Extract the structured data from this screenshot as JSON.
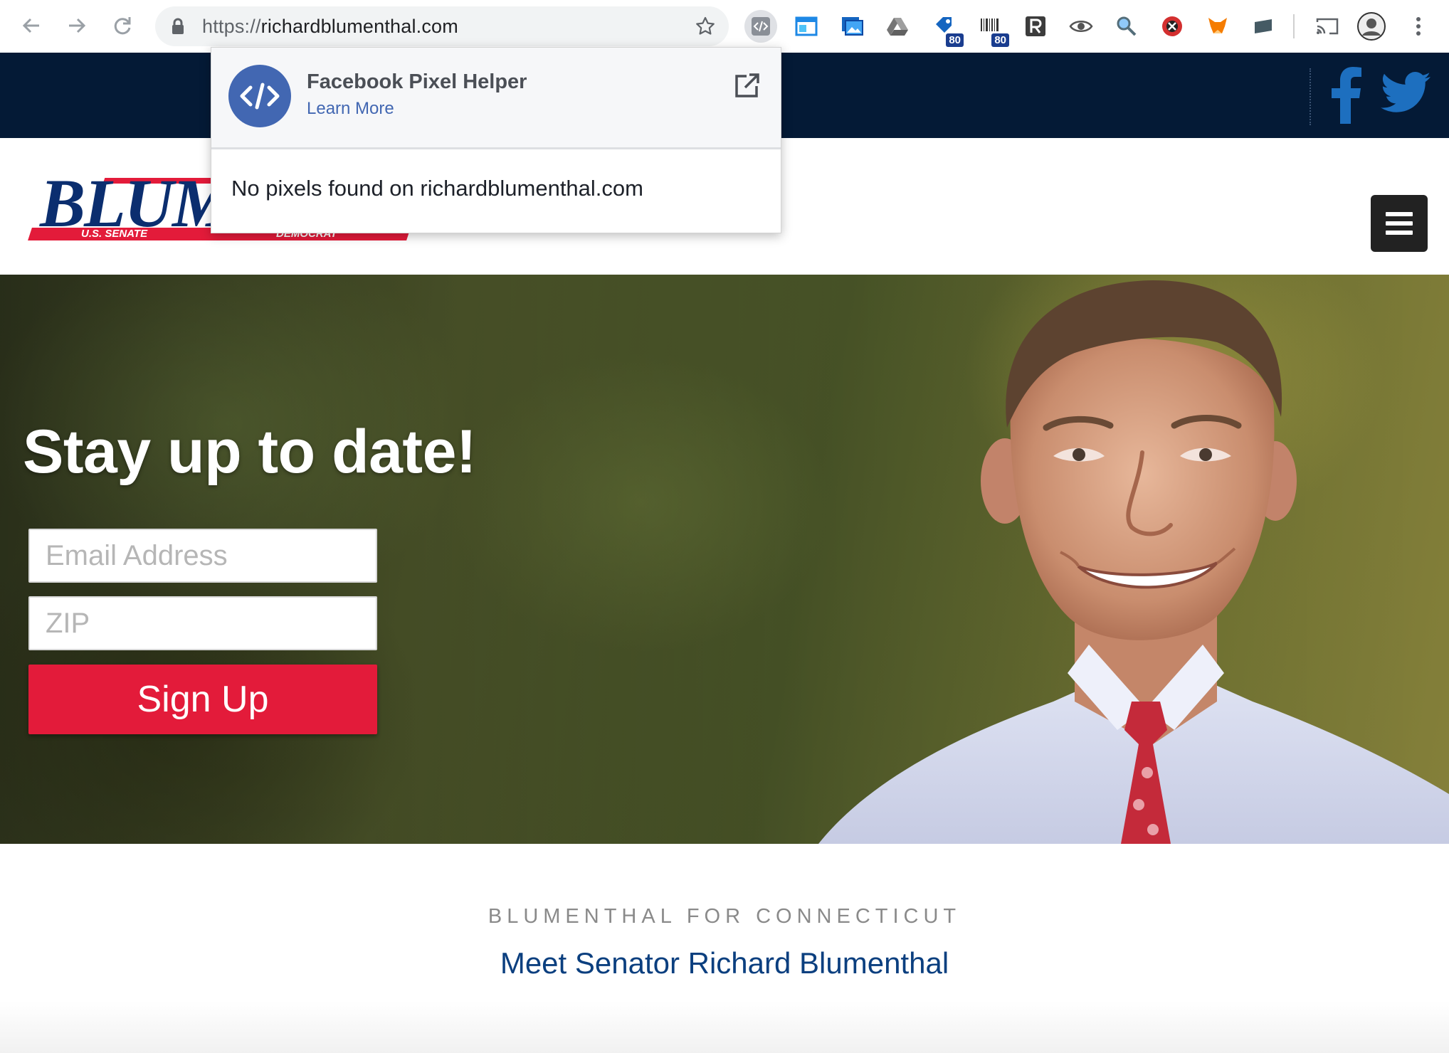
{
  "browser": {
    "url_scheme": "https://",
    "url_host": "richardblumenthal.com",
    "extension_badges": [
      "80",
      "80"
    ]
  },
  "logo": {
    "name": "BLUM",
    "office": "U.S. SENATE",
    "party": "DEMOCRAT"
  },
  "hero": {
    "heading": "Stay up to date!",
    "email_placeholder": "Email Address",
    "zip_placeholder": "ZIP",
    "signup_label": "Sign Up"
  },
  "intro": {
    "kicker": "BLUMENTHAL FOR CONNECTICUT",
    "link_text": "Meet Senator Richard Blumenthal"
  },
  "popup": {
    "title": "Facebook Pixel Helper",
    "learn_more": "Learn More",
    "message": "No pixels found on richardblumenthal.com"
  },
  "colors": {
    "navy_bar": "#041a36",
    "accent_red": "#e31b3a",
    "facebook_blue": "#4267b2",
    "social_blue": "#1d6fbf",
    "link_blue": "#0b3f7f"
  }
}
